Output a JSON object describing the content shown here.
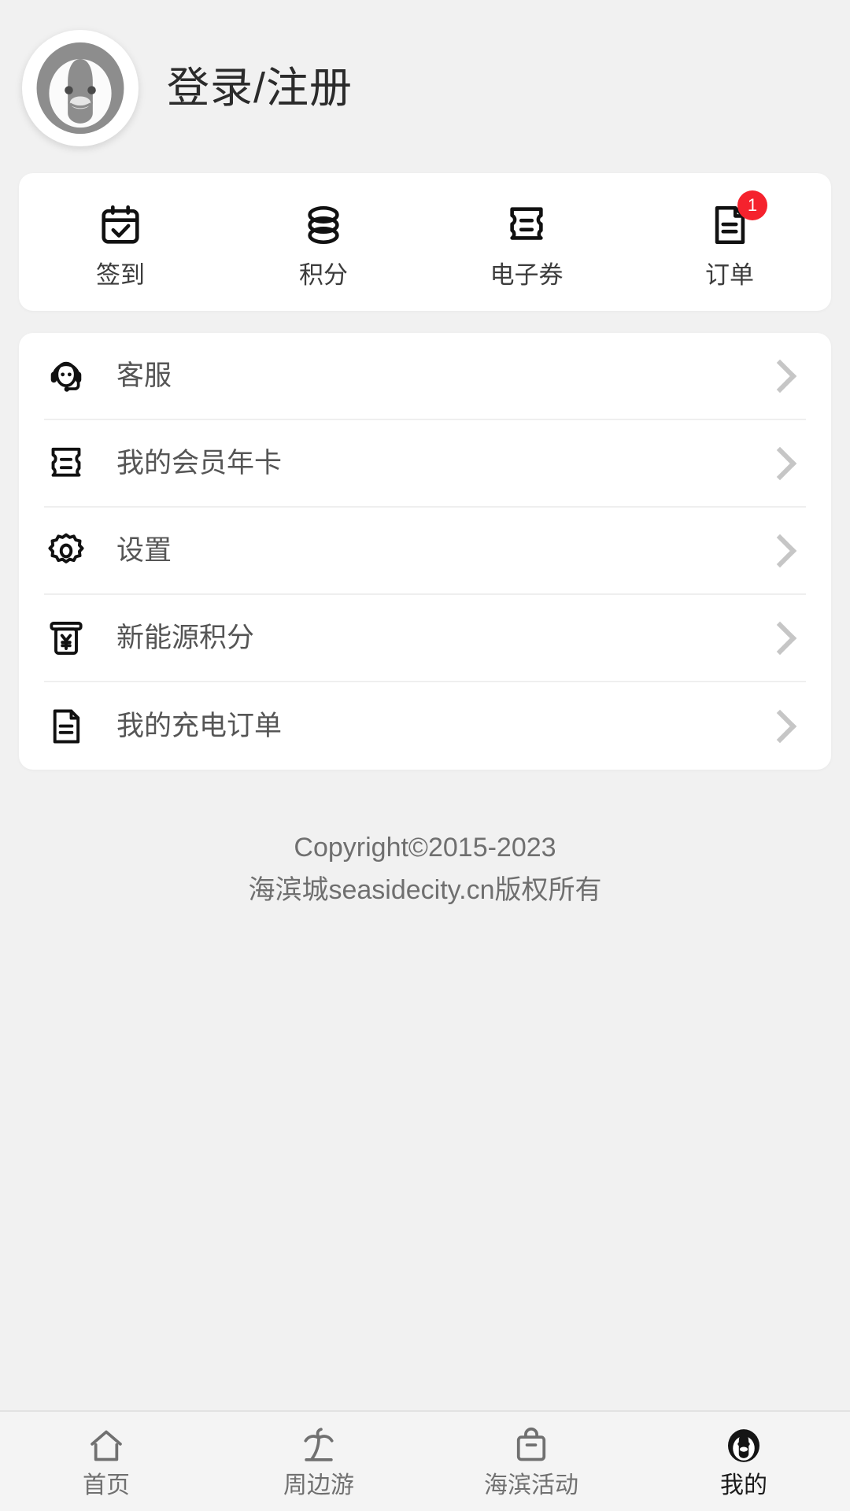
{
  "header": {
    "avatar_icon": "penguin-avatar-icon",
    "login_label": "登录/注册"
  },
  "quick_actions": [
    {
      "label": "签到",
      "icon": "calendar-check-icon",
      "badge": ""
    },
    {
      "label": "积分",
      "icon": "coins-stack-icon",
      "badge": ""
    },
    {
      "label": "电子券",
      "icon": "ticket-icon",
      "badge": ""
    },
    {
      "label": "订单",
      "icon": "document-list-icon",
      "badge": "1"
    }
  ],
  "menu": [
    {
      "label": "客服",
      "icon": "headset-support-icon"
    },
    {
      "label": "我的会员年卡",
      "icon": "ticket-icon"
    },
    {
      "label": "设置",
      "icon": "gear-icon"
    },
    {
      "label": "新能源积分",
      "icon": "atm-yen-icon"
    },
    {
      "label": "我的充电订单",
      "icon": "document-lines-icon"
    }
  ],
  "copyright": {
    "line1": "Copyright©2015-2023",
    "line2": "海滨城seasidecity.cn版权所有"
  },
  "tabbar": {
    "items": [
      {
        "label": "首页",
        "icon": "home-icon",
        "active": false
      },
      {
        "label": "周边游",
        "icon": "palm-island-icon",
        "active": false
      },
      {
        "label": "海滨活动",
        "icon": "shopping-bag-icon",
        "active": false
      },
      {
        "label": "我的",
        "icon": "penguin-icon",
        "active": true
      }
    ]
  },
  "colors": {
    "page_bg": "#f1f1f1",
    "card_bg": "#ffffff",
    "badge_red": "#f5222d",
    "text_primary": "#2b2b2b",
    "text_secondary": "#555555",
    "chevron": "#c6c6c6"
  }
}
